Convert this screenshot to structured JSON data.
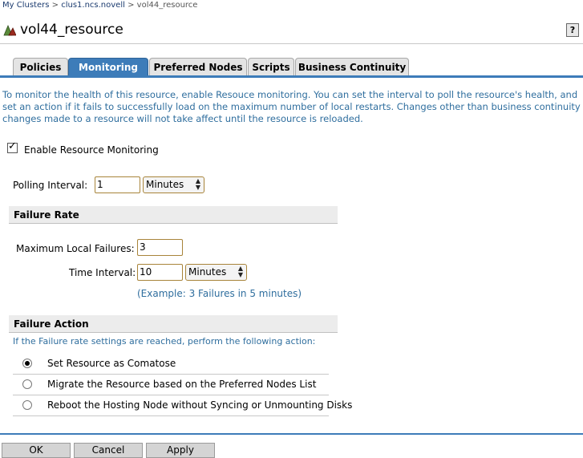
{
  "breadcrumb": {
    "items": [
      "My Clusters",
      "clus1.ncs.novell",
      "vol44_resource"
    ],
    "separator": ">"
  },
  "header": {
    "title": "vol44_resource",
    "help_label": "?",
    "icon": "cluster-resource-icon"
  },
  "tabs": [
    {
      "label": "Policies",
      "active": false
    },
    {
      "label": "Monitoring",
      "active": true
    },
    {
      "label": "Preferred Nodes",
      "active": false
    },
    {
      "label": "Scripts",
      "active": false
    },
    {
      "label": "Business Continuity",
      "active": false
    }
  ],
  "intro_text": "To monitor the health of this resource, enable Resouce monitoring. You can set the interval to poll the resource's health, and set an action if it fails to successfully load on the maximum number of local restarts. Changes other than business continuity changes made to a resource will not take affect until the resource is reloaded.",
  "monitoring": {
    "enable_label": "Enable Resource Monitoring",
    "enabled": true,
    "polling_label": "Polling Interval:",
    "polling_value": "1",
    "polling_unit": "Minutes"
  },
  "failure_rate": {
    "heading": "Failure Rate",
    "max_failures_label": "Maximum Local Failures:",
    "max_failures_value": "3",
    "time_interval_label": "Time Interval:",
    "time_interval_value": "10",
    "time_interval_unit": "Minutes",
    "example": "(Example: 3 Failures in 5 minutes)"
  },
  "failure_action": {
    "heading": "Failure Action",
    "note": "If the Failure rate settings are reached, perform the following action:",
    "options": [
      {
        "label": "Set Resource as Comatose",
        "selected": true
      },
      {
        "label": "Migrate the Resource based on the Preferred Nodes List",
        "selected": false
      },
      {
        "label": "Reboot the Hosting Node without Syncing or Unmounting Disks",
        "selected": false
      }
    ]
  },
  "buttons": {
    "ok": "OK",
    "cancel": "Cancel",
    "apply": "Apply"
  },
  "colors": {
    "accent": "#3d7cb9",
    "info_text": "#2f6e9e"
  }
}
